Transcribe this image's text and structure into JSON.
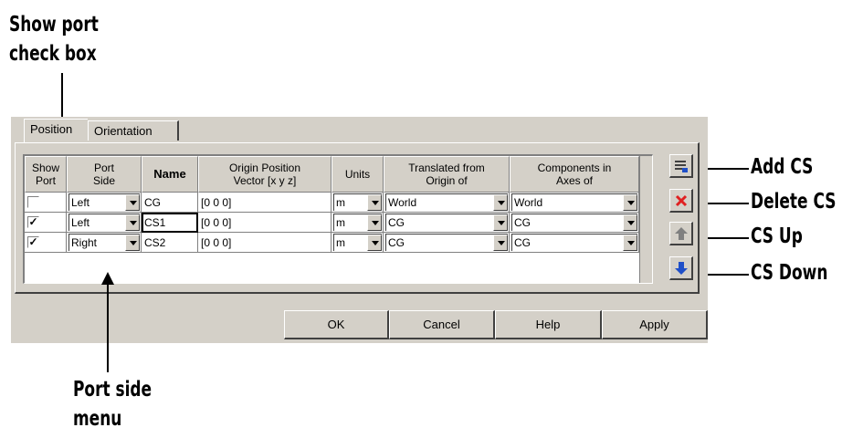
{
  "callouts": {
    "show_port_line1": "Show port",
    "show_port_line2": "check box",
    "add_cs": "Add CS",
    "delete_cs": "Delete CS",
    "cs_up": "CS Up",
    "cs_down": "CS Down",
    "port_side_line1": "Port side",
    "port_side_line2": "menu"
  },
  "tabs": [
    {
      "label": "Position",
      "active": true
    },
    {
      "label": "Orientation",
      "active": false
    }
  ],
  "table": {
    "headers": {
      "show_port_1": "Show",
      "show_port_2": "Port",
      "port_side_1": "Port",
      "port_side_2": "Side",
      "name": "Name",
      "origin_1": "Origin Position",
      "origin_2": "Vector [x y z]",
      "units": "Units",
      "translated_1": "Translated from",
      "translated_2": "Origin of",
      "components_1": "Components in",
      "components_2": "Axes of"
    },
    "rows": [
      {
        "show_port": false,
        "port_side": "Left",
        "name": "CG",
        "origin": "[0 0 0]",
        "units": "m",
        "translated": "World",
        "components": "World"
      },
      {
        "show_port": true,
        "port_side": "Left",
        "name": "CS1",
        "origin": "[0 0 0]",
        "units": "m",
        "translated": "CG",
        "components": "CG"
      },
      {
        "show_port": true,
        "port_side": "Right",
        "name": "CS2",
        "origin": "[0 0 0]",
        "units": "m",
        "translated": "CG",
        "components": "CG"
      }
    ]
  },
  "side_buttons": [
    "add-cs-icon",
    "delete-cs-icon",
    "move-up-icon",
    "move-down-icon"
  ],
  "buttons": {
    "ok": "OK",
    "cancel": "Cancel",
    "help": "Help",
    "apply": "Apply"
  },
  "colors": {
    "dialog_bg": "#d4d0c8",
    "delete_red": "#e02020",
    "arrow_blue": "#1f4fc8"
  }
}
